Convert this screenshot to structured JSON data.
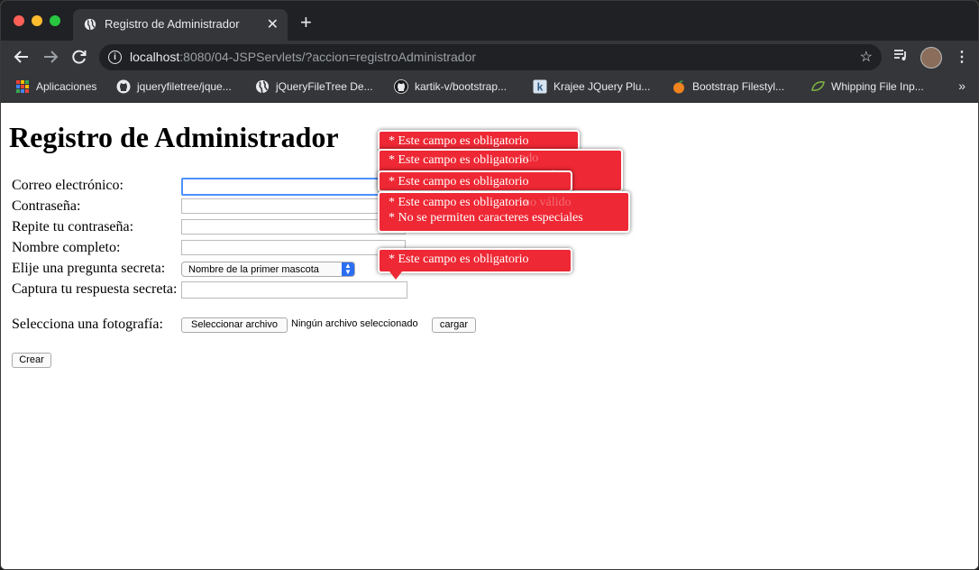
{
  "browser": {
    "tab_title": "Registro de Administrador",
    "tab_close": "✕",
    "new_tab": "+",
    "url_host": "localhost",
    "url_rest": ":8080/04-JSPServlets/?accion=registroAdministrador",
    "star": "☆",
    "menu": "⋮",
    "bookmarks": [
      {
        "label": "Aplicaciones",
        "icon": "apps-grid-icon"
      },
      {
        "label": "jqueryfiletree/jque...",
        "icon": "github-icon"
      },
      {
        "label": "jQueryFileTree De...",
        "icon": "globe-icon"
      },
      {
        "label": "kartik-v/bootstrap...",
        "icon": "github-icon"
      },
      {
        "label": "Krajee JQuery Plu...",
        "icon": "krajee-k-icon"
      },
      {
        "label": "Bootstrap Filestyl...",
        "icon": "orange-icon"
      },
      {
        "label": "Whipping File Inp...",
        "icon": "leaf-icon"
      }
    ],
    "bookmarks_more": "»"
  },
  "page": {
    "title": "Registro de Administrador",
    "labels": {
      "email": "Correo electrónico:",
      "password": "Contraseña:",
      "password_repeat": "Repite tu contraseña:",
      "full_name": "Nombre completo:",
      "secret_question": "Elije una pregunta secreta:",
      "secret_answer": "Captura tu respuesta secreta:",
      "photo": "Selecciona una fotografía:"
    },
    "fields": {
      "email": "",
      "password": "",
      "password_repeat": "",
      "full_name": "",
      "secret_answer": ""
    },
    "secret_question_selected": "Nombre de la primer mascota",
    "file_button": "Seleccionar archivo",
    "file_status": "Ningún archivo seleccionado",
    "upload_button": "cargar",
    "create_button": "Crear"
  },
  "validation": {
    "required": "* Este campo es obligatorio",
    "hidden_fragment_1": "ado",
    "hidden_fragment_2": "torizados",
    "hidden_fragment_3": "no válido",
    "no_special_chars": "* No se permiten caracteres especiales"
  },
  "colors": {
    "tooltip_red": "#ee2834",
    "focus_blue": "#4d90fe",
    "chrome_dark": "#202124",
    "chrome_mid": "#35363a"
  }
}
